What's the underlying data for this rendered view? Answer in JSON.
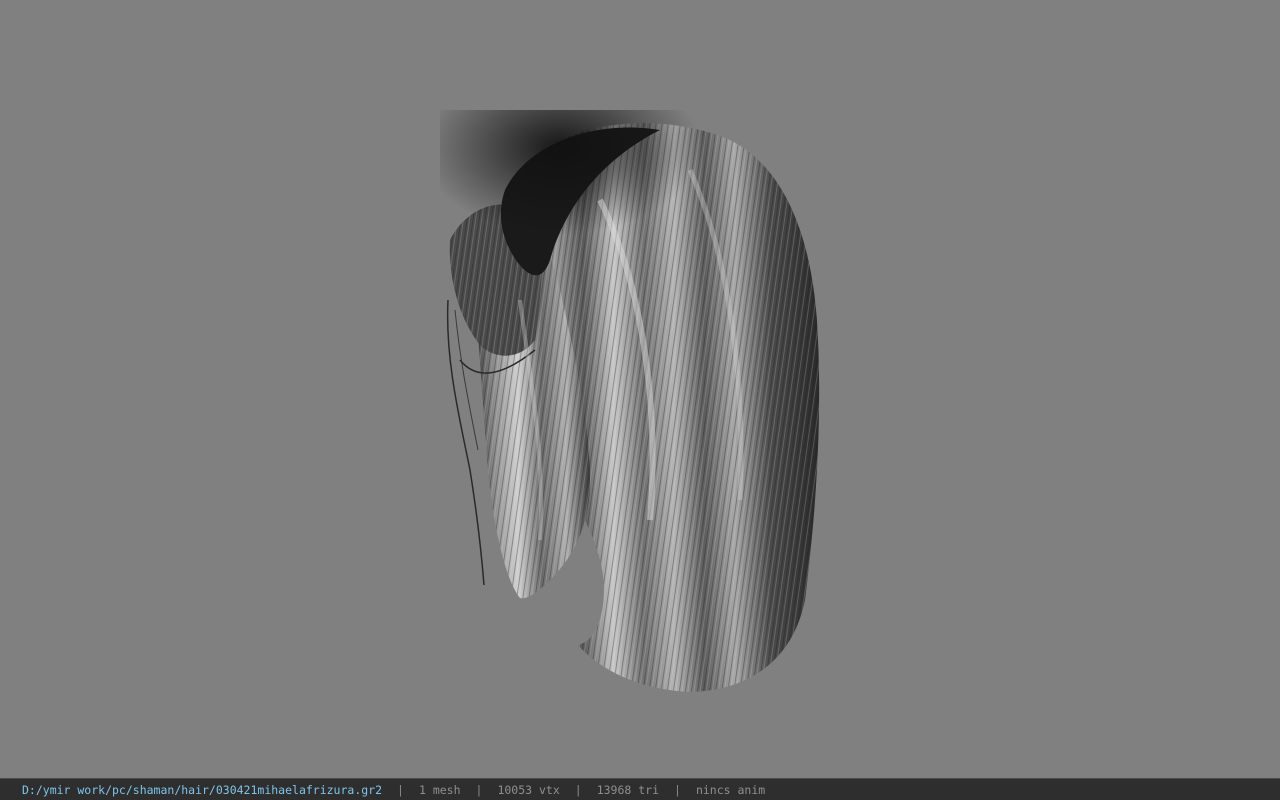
{
  "viewport": {
    "background": "#808080",
    "model": "hair-mesh"
  },
  "statusbar": {
    "file_path": "D:/ymir work/pc/shaman/hair/030421mihaelafrizura.gr2",
    "separator": "|",
    "mesh_count": "1 mesh",
    "vertex_count": "10053 vtx",
    "triangle_count": "13968 tri",
    "anim_status": "nincs anim",
    "path_color": "#7ec4ea"
  }
}
